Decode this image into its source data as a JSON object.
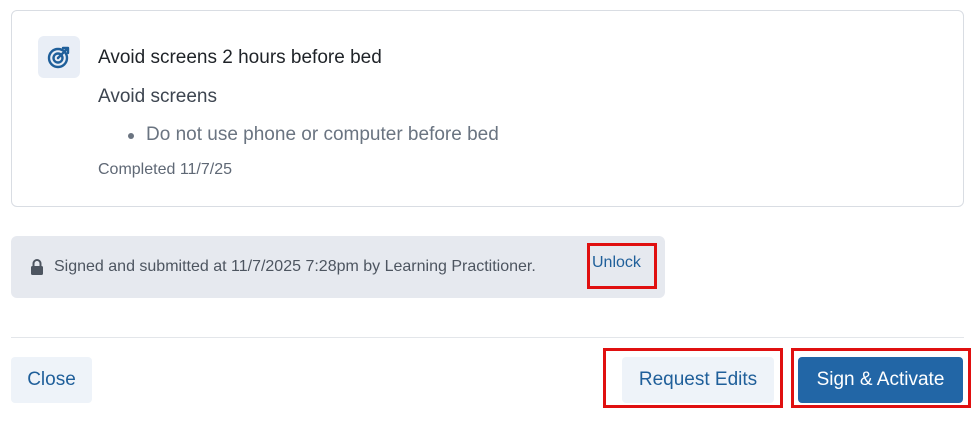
{
  "goal": {
    "icon": "target-icon",
    "title": "Avoid screens 2 hours before bed",
    "subtitle": "Avoid screens",
    "bullets": [
      "Do not use phone or computer before bed"
    ],
    "completed": "Completed 11/7/25"
  },
  "signed_banner": {
    "icon": "lock-icon",
    "text": "Signed and submitted at 11/7/2025 7:28pm by Learning Practitioner.",
    "unlock_label": "Unlock"
  },
  "footer": {
    "close_label": "Close",
    "request_edits_label": "Request Edits",
    "sign_activate_label": "Sign & Activate"
  },
  "colors": {
    "accent": "#2266a6",
    "link": "#1f5f9a",
    "highlight": "#e01010",
    "banner_bg": "#e6e9ef"
  }
}
